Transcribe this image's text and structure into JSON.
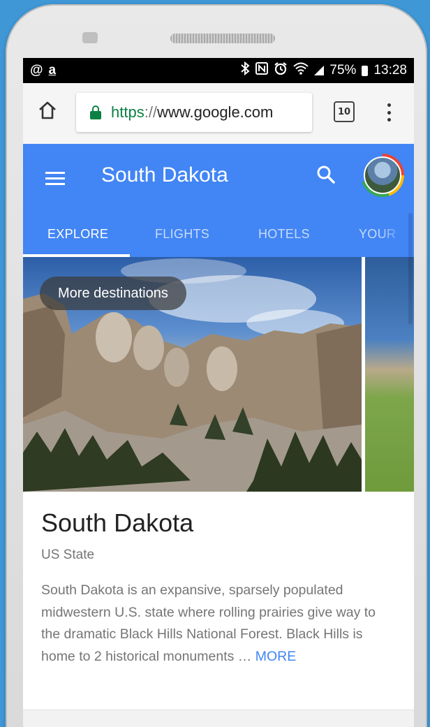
{
  "status_bar": {
    "left_icons": [
      "@",
      "a"
    ],
    "battery_percent": "75%",
    "time": "13:28",
    "icons": [
      "bluetooth-icon",
      "nfc-icon",
      "alarm-icon",
      "wifi-icon",
      "signal-icon",
      "battery-icon"
    ]
  },
  "browser": {
    "url_scheme": "https",
    "url_sep": "://",
    "url_host": "www.google.com",
    "tab_count": "10"
  },
  "header": {
    "title": "South Dakota",
    "tabs": [
      {
        "label": "EXPLORE",
        "active": true
      },
      {
        "label": "FLIGHTS",
        "active": false
      },
      {
        "label": "HOTELS",
        "active": false
      },
      {
        "label": "YOUR",
        "active": false
      }
    ]
  },
  "hero": {
    "chip_label": "More destinations"
  },
  "place": {
    "title": "South Dakota",
    "type": "US State",
    "description": "South Dakota is an expansive, sparsely populated midwestern U.S. state where rolling prairies give way to the dramatic Black Hills National Forest. Black Hills is home to 2 historical monuments … ",
    "more_label": "MORE"
  },
  "colors": {
    "brand_blue": "#4285f4",
    "secure_green": "#0b8043",
    "background": "#3f97d6"
  }
}
